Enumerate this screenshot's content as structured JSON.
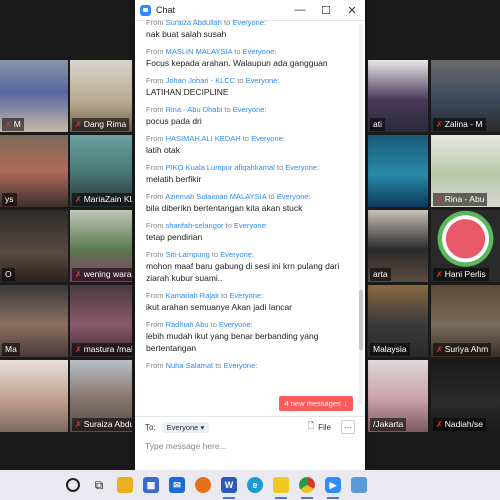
{
  "chat_window": {
    "title": "Chat",
    "messages": [
      {
        "from": "Suraiza Abdullah",
        "to": "Everyone:",
        "text": "nak buat salah susah"
      },
      {
        "from": "MASLIN MALAYSIA",
        "to": "Everyone:",
        "text": "Focus kepada arahan. Walaupun ada gangguan"
      },
      {
        "from": "Johan Johari - KLCC",
        "to": "Everyone:",
        "text": "LATIHAN DECIPLINE"
      },
      {
        "from": "Rina - Abu Dhabi",
        "to": "Everyone:",
        "text": "pocus pada dri"
      },
      {
        "from": "HASIMAH ALI KEDAH",
        "to": "Everyone:",
        "text": "latih otak"
      },
      {
        "from": "PIKO Kuala Lumpur afiqahkamal",
        "to": "Everyone:",
        "text": "melatih berfikir"
      },
      {
        "from": "Aziemah Sulaiman MALAYSIA",
        "to": "Everyone:",
        "text": "bila diberikn bertentangan kita akan stuck"
      },
      {
        "from": "sharifah-selangor",
        "to": "Everyone:",
        "text": "tetap pendirian"
      },
      {
        "from": "Siti-Lampung",
        "to": "Everyone:",
        "text": "mohon maaf baru gabung di sesi ini  krn pulang dari ziarah kubur suami.."
      },
      {
        "from": "Kamariah Rajak",
        "to": "Everyone:",
        "text": "ikut arahan semuanye Akan jadi lancar"
      },
      {
        "from": "Radhiah Abu",
        "to": "Everyone:",
        "text": "lebih mudah ikut yang benar berbanding yang bertentangan"
      },
      {
        "from": "Nuha Salamat",
        "to": "Everyone:",
        "text": ""
      }
    ],
    "from_word": "From",
    "to_word": "to",
    "new_messages": "4 new messages",
    "to_label": "To:",
    "recipient": "Everyone",
    "file_label": "File",
    "placeholder": "Type message here..."
  },
  "participants": [
    {
      "label": "Dang Rima",
      "muted": true
    },
    {
      "label": "MariaZain KL",
      "muted": true
    },
    {
      "label": "wening warastuti",
      "muted": true
    },
    {
      "label": "mastura /malays",
      "muted": true
    },
    {
      "label": "Suraiza Abdullah",
      "muted": true
    },
    {
      "label": "ati",
      "muted": false
    },
    {
      "label": "Zalina - M",
      "muted": true
    },
    {
      "label": "Rina - Abu",
      "muted": true
    },
    {
      "label": "arta",
      "muted": false
    },
    {
      "label": "Hani Perlis",
      "muted": true
    },
    {
      "label": "Malaysia",
      "muted": false
    },
    {
      "label": "Suriya Ahm",
      "muted": true
    },
    {
      "label": "/Jakarta",
      "muted": false
    },
    {
      "label": "Nadiah/se",
      "muted": true
    },
    {
      "label": "M",
      "muted": false
    },
    {
      "label": "ys",
      "muted": false
    },
    {
      "label": "O",
      "muted": false
    },
    {
      "label": "Ma",
      "muted": false
    }
  ],
  "taskbar_icons": [
    "search-icon",
    "task-view-icon",
    "file-explorer-icon",
    "store-icon",
    "mail-icon",
    "firefox-icon",
    "word-icon",
    "edge-icon",
    "sticky-notes-icon",
    "chrome-icon",
    "zoom-icon",
    "paint-icon"
  ],
  "colors": {
    "accent": "#2d8cff",
    "new_messages": "#ff5b5b",
    "muted_mic": "#e0393e"
  }
}
